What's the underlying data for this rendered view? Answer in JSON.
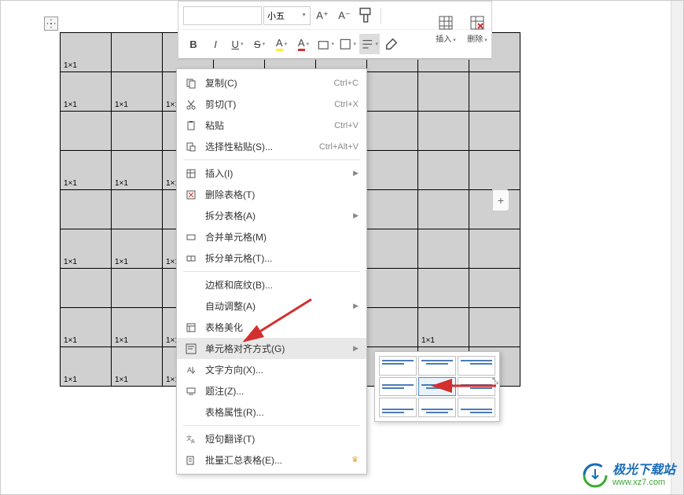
{
  "toolbar": {
    "font_size": "小五",
    "a_plus": "A⁺",
    "a_minus": "A⁻",
    "bold": "B",
    "italic": "I",
    "underline": "U",
    "strike": "S",
    "highlight": "A",
    "fontcolor": "A",
    "insert_label": "插入",
    "delete_label": "删除"
  },
  "table": {
    "cell_text": "1×1",
    "rows": 9,
    "cols": 9
  },
  "menu": {
    "copy": {
      "label": "复制(C)",
      "shortcut": "Ctrl+C"
    },
    "cut": {
      "label": "剪切(T)",
      "shortcut": "Ctrl+X"
    },
    "paste": {
      "label": "粘贴",
      "shortcut": "Ctrl+V"
    },
    "paste_special": {
      "label": "选择性粘贴(S)...",
      "shortcut": "Ctrl+Alt+V"
    },
    "insert": {
      "label": "插入(I)"
    },
    "delete_table": {
      "label": "删除表格(T)"
    },
    "split_table": {
      "label": "拆分表格(A)"
    },
    "merge_cells": {
      "label": "合并单元格(M)"
    },
    "split_cells": {
      "label": "拆分单元格(T)..."
    },
    "borders": {
      "label": "边框和底纹(B)..."
    },
    "autofit": {
      "label": "自动调整(A)"
    },
    "beautify": {
      "label": "表格美化"
    },
    "align": {
      "label": "单元格对齐方式(G)"
    },
    "text_direction": {
      "label": "文字方向(X)..."
    },
    "caption": {
      "label": "题注(Z)..."
    },
    "properties": {
      "label": "表格属性(R)..."
    },
    "translate": {
      "label": "短句翻译(T)"
    },
    "batch": {
      "label": "批量汇总表格(E)..."
    }
  },
  "watermark": {
    "title": "极光下载站",
    "url": "www.xz7.com"
  }
}
